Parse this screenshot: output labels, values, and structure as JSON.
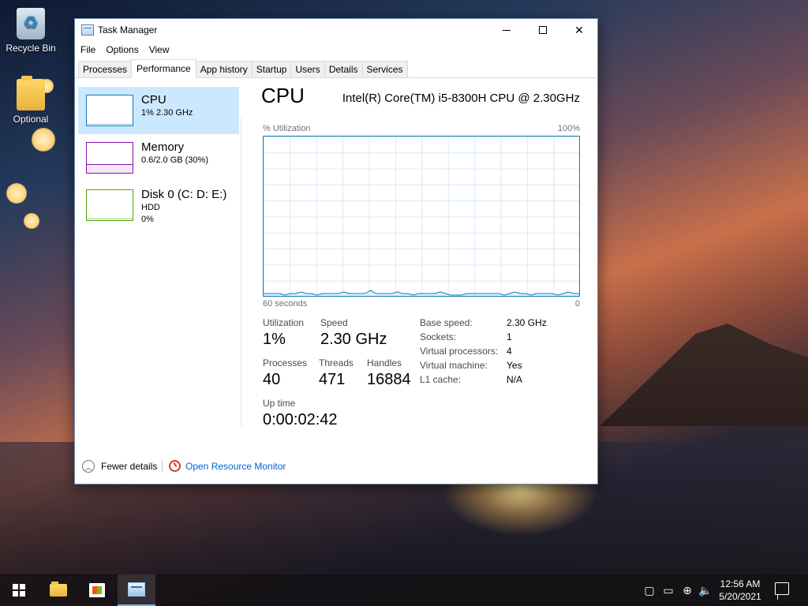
{
  "desktop": {
    "icons": [
      {
        "label": "Recycle Bin",
        "icon": "recycle-bin-icon"
      },
      {
        "label": "Optional",
        "icon": "folder-icon"
      }
    ]
  },
  "window": {
    "title": "Task Manager",
    "menu": [
      "File",
      "Options",
      "View"
    ],
    "tabs": [
      "Processes",
      "Performance",
      "App history",
      "Startup",
      "Users",
      "Details",
      "Services"
    ],
    "active_tab": "Performance"
  },
  "sidebar": {
    "items": [
      {
        "title": "CPU",
        "line1": "1%  2.30 GHz",
        "line2": "",
        "color": "#117dbb"
      },
      {
        "title": "Memory",
        "line1": "0.6/2.0 GB (30%)",
        "line2": "",
        "color": "#8b12ae"
      },
      {
        "title": "Disk 0 (C: D: E:)",
        "line1": "HDD",
        "line2": "0%",
        "color": "#4da60c"
      }
    ]
  },
  "main": {
    "title": "CPU",
    "model": "Intel(R) Core(TM) i5-8300H CPU @ 2.30GHz",
    "graph": {
      "y_label": "% Utilization",
      "y_max_label": "100%",
      "x_left_label": "60 seconds",
      "x_right_label": "0",
      "utilization_history": [
        1,
        1,
        1,
        1,
        0,
        1,
        1,
        2,
        1,
        1,
        0,
        1,
        1,
        1,
        1,
        2,
        1,
        1,
        1,
        1,
        3,
        1,
        1,
        1,
        1,
        2,
        1,
        1,
        0,
        1,
        1,
        1,
        1,
        2,
        1,
        0,
        0,
        0,
        1,
        1,
        1,
        1,
        1,
        1,
        1,
        0,
        1,
        2,
        1,
        1,
        0,
        1,
        1,
        1,
        1,
        0,
        1,
        2,
        1,
        1
      ]
    },
    "stats": {
      "utilization_label": "Utilization",
      "utilization": "1%",
      "speed_label": "Speed",
      "speed": "2.30 GHz",
      "processes_label": "Processes",
      "processes": "40",
      "threads_label": "Threads",
      "threads": "471",
      "handles_label": "Handles",
      "handles": "16884",
      "uptime_label": "Up time",
      "uptime": "0:00:02:42"
    },
    "specs": [
      {
        "key": "Base speed:",
        "value": "2.30 GHz"
      },
      {
        "key": "Sockets:",
        "value": "1"
      },
      {
        "key": "Virtual processors:",
        "value": "4"
      },
      {
        "key": "Virtual machine:",
        "value": "Yes"
      },
      {
        "key": "L1 cache:",
        "value": "N/A"
      }
    ]
  },
  "footer": {
    "fewer_details": "Fewer details",
    "resource_monitor": "Open Resource Monitor"
  },
  "taskbar": {
    "time": "12:56 AM",
    "date": "5/20/2021"
  }
}
